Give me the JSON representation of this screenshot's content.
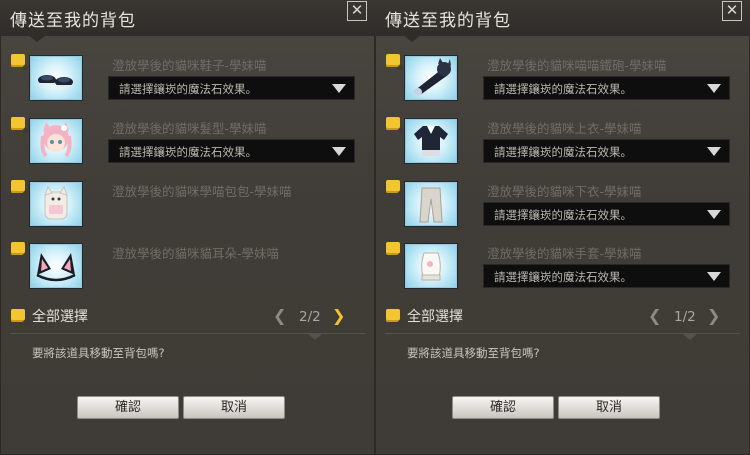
{
  "panels": [
    {
      "title": "傳送至我的背包",
      "items": [
        {
          "name": "澄放學後的貓咪鞋子-學妹喵",
          "select": "請選擇鑲崁的魔法石效果。",
          "icon": "cat-shoes-icon",
          "has_select": true
        },
        {
          "name": "澄放學後的貓咪髮型-學妹喵",
          "select": "請選擇鑲崁的魔法石效果。",
          "icon": "cat-hairstyle-icon",
          "has_select": true
        },
        {
          "name": "澄放學後的貓咪學喵包包-學妹喵",
          "select": "",
          "icon": "cat-backpack-icon",
          "has_select": false
        },
        {
          "name": "澄放學後的貓咪貓耳朵-學妹喵",
          "select": "",
          "icon": "cat-ears-icon",
          "has_select": false
        }
      ],
      "select_all": "全部選擇",
      "page": "2/2",
      "question": "要將該道具移動至背包嗎?",
      "ok": "確認",
      "cancel": "取消"
    },
    {
      "title": "傳送至我的背包",
      "items": [
        {
          "name": "澄放學後的貓咪喵喵鐵砲-學妹喵",
          "select": "請選擇鑲崁的魔法石效果。",
          "icon": "cat-cannon-icon",
          "has_select": true
        },
        {
          "name": "澄放學後的貓咪上衣-學妹喵",
          "select": "請選擇鑲崁的魔法石效果。",
          "icon": "cat-top-icon",
          "has_select": true
        },
        {
          "name": "澄放學後的貓咪下衣-學妹喵",
          "select": "請選擇鑲崁的魔法石效果。",
          "icon": "cat-pants-icon",
          "has_select": true
        },
        {
          "name": "澄放學後的貓咪手套-學妹喵",
          "select": "請選擇鑲崁的魔法石效果。",
          "icon": "cat-gloves-icon",
          "has_select": true
        }
      ],
      "select_all": "全部選擇",
      "page": "1/2",
      "question": "要將該道具移動至背包嗎?",
      "ok": "確認",
      "cancel": "取消"
    }
  ],
  "colors": {
    "checkbox": "#f2c531",
    "pager_active": "#f4c430",
    "item_name": "#706c66"
  }
}
